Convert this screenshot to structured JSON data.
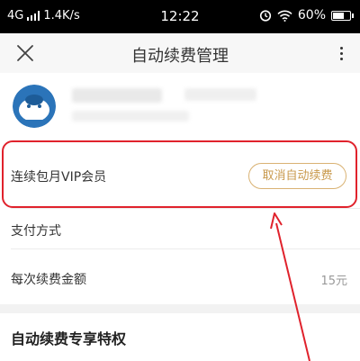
{
  "status_bar": {
    "network": "4G",
    "speed": "1.4K/s",
    "time": "12:22",
    "battery": "60%"
  },
  "title_bar": {
    "title": "自动续费管理"
  },
  "renewal": {
    "plan_label": "连续包月VIP会员",
    "cancel_label": "取消自动续费"
  },
  "payment": {
    "label": "支付方式"
  },
  "amount": {
    "label": "每次续费金额",
    "value": "15元"
  },
  "section": {
    "title": "自动续费专享特权"
  },
  "colors": {
    "annotation": "#e0222c",
    "button_border": "#d9b273",
    "button_text": "#c99a4e"
  }
}
